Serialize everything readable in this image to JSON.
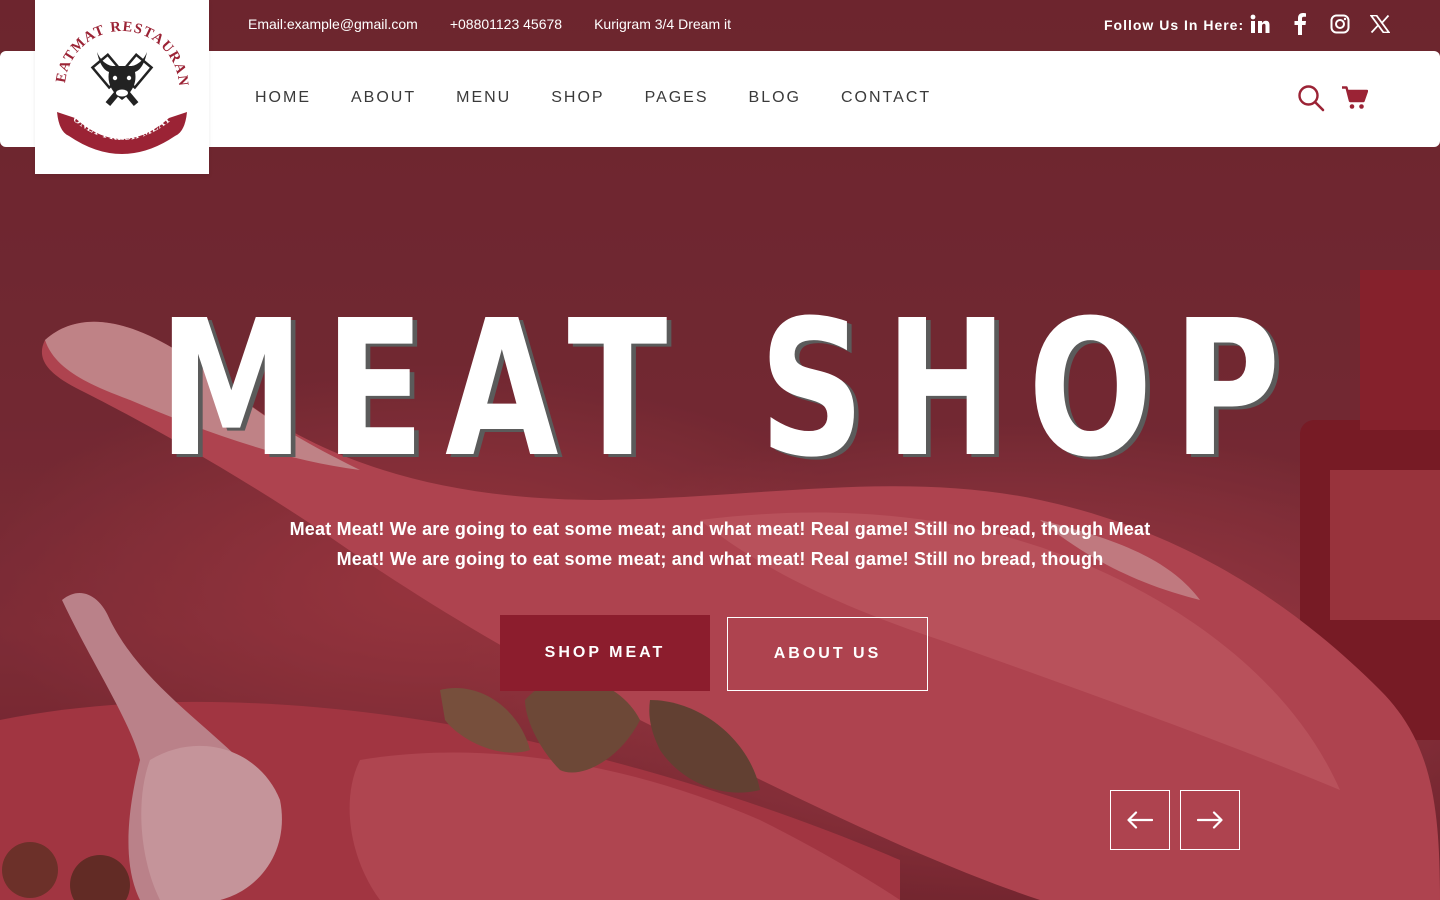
{
  "topbar": {
    "email": "Email:example@gmail.com",
    "phone": "+08801123 45678",
    "address": "Kurigram 3/4 Dream it",
    "follow_label": "Follow Us In Here:",
    "socials": [
      "linkedin-icon",
      "facebook-icon",
      "instagram-icon",
      "x-icon"
    ]
  },
  "logo": {
    "arc_text": "MEATMAT RESTAURANT",
    "ribbon_text": "ONLY FRESH MEAT"
  },
  "nav": {
    "items": [
      "HOME",
      "ABOUT",
      "MENU",
      "SHOP",
      "PAGES",
      "BLOG",
      "CONTACT"
    ],
    "icons": [
      "search-icon",
      "cart-icon"
    ]
  },
  "hero": {
    "headline": "MEAT SHOP",
    "description": "Meat Meat! We are going to eat some meat; and what meat! Real game! Still no bread, though Meat Meat! We are going to eat some meat; and what meat! Real game! Still no bread, though",
    "primary_button": "SHOP MEAT",
    "secondary_button": "ABOUT US",
    "arrows": [
      "arrow-left-icon",
      "arrow-right-icon"
    ]
  },
  "colors": {
    "brand": "#8c1d2d",
    "icon_accent": "#9b2335",
    "nav_text": "#3a3a3a"
  }
}
